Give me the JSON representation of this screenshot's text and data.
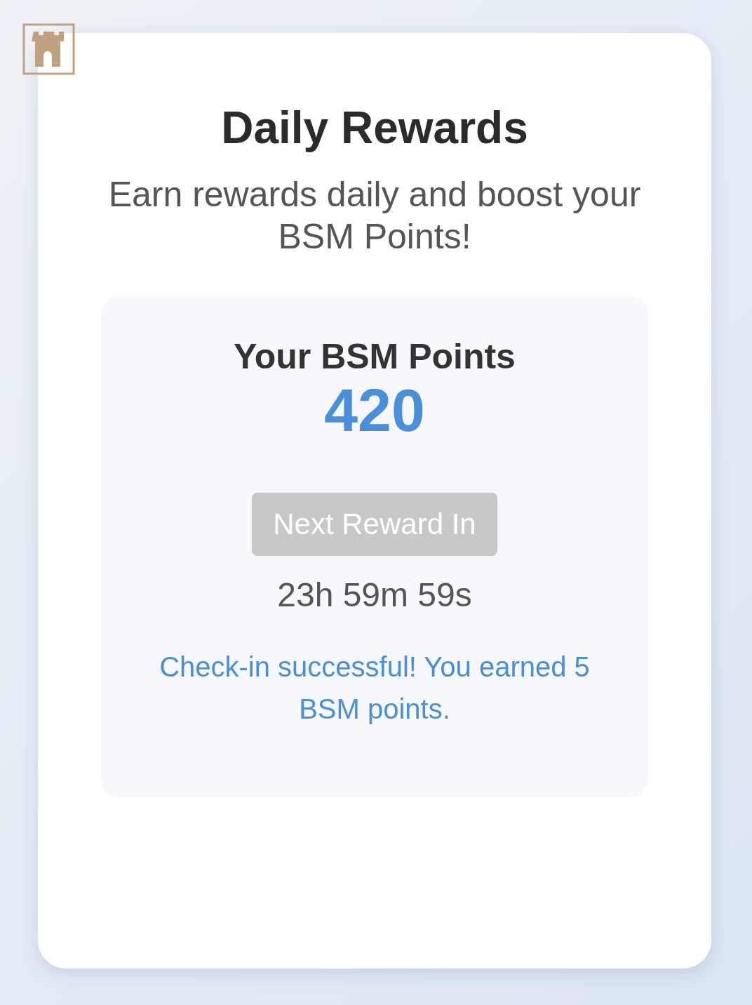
{
  "title": "Daily Rewards",
  "subtitle": "Earn rewards daily and boost your BSM Points!",
  "points": {
    "label": "Your BSM Points",
    "value": "420"
  },
  "reward_button": {
    "label": "Next Reward In",
    "disabled": true
  },
  "countdown": "23h 59m 59s",
  "message": "Check-in successful! You earned 5 BSM points."
}
